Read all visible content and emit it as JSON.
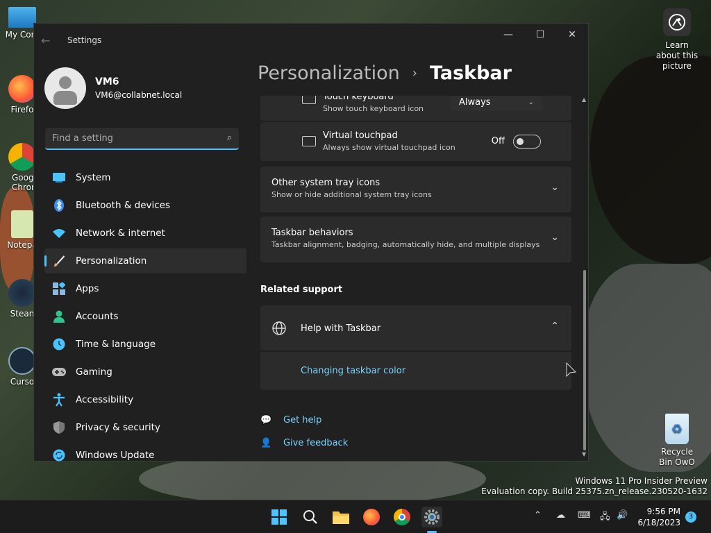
{
  "desktop": {
    "icons_left": [
      {
        "label": "My Com",
        "icon": "monitor-icon"
      },
      {
        "label": "Firefo",
        "icon": "firefox-icon"
      },
      {
        "label": "Goog Chron",
        "icon": "chrome-icon"
      },
      {
        "label": "Notepa",
        "icon": "notepad-icon"
      },
      {
        "label": "Stean",
        "icon": "steam-icon"
      },
      {
        "label": "Curso",
        "icon": "cursor-icon"
      }
    ],
    "learn_about": "Learn about this picture",
    "recycle_bin": "Recycle Bin OwO",
    "watermark_line1": "Windows 11 Pro Insider Preview",
    "watermark_line2": "Evaluation copy. Build 25375.zn_release.230520-1632"
  },
  "window": {
    "title": "Settings",
    "controls": [
      "—",
      "☐",
      "✕"
    ]
  },
  "profile": {
    "name": "VM6",
    "email": "VM6@collabnet.local"
  },
  "search": {
    "placeholder": "Find a setting"
  },
  "nav": [
    {
      "label": "System",
      "icon": "system-icon",
      "color": "#4cc2ff"
    },
    {
      "label": "Bluetooth & devices",
      "icon": "bluetooth-icon",
      "color": "#3b8eea"
    },
    {
      "label": "Network & internet",
      "icon": "wifi-icon",
      "color": "#4cc2ff"
    },
    {
      "label": "Personalization",
      "icon": "brush-icon",
      "color": "#e8a87c",
      "active": true
    },
    {
      "label": "Apps",
      "icon": "apps-icon",
      "color": "#8fb8de"
    },
    {
      "label": "Accounts",
      "icon": "accounts-icon",
      "color": "#2cc58b"
    },
    {
      "label": "Time & language",
      "icon": "time-language-icon",
      "color": "#4cc2ff"
    },
    {
      "label": "Gaming",
      "icon": "gaming-icon",
      "color": "#aaa"
    },
    {
      "label": "Accessibility",
      "icon": "accessibility-icon",
      "color": "#4cc2ff"
    },
    {
      "label": "Privacy & security",
      "icon": "shield-icon",
      "color": "#aaa"
    },
    {
      "label": "Windows Update",
      "icon": "update-icon",
      "color": "#4cc2ff"
    }
  ],
  "content": {
    "breadcrumb_parent": "Personalization",
    "breadcrumb_sep": "›",
    "breadcrumb_current": "Taskbar",
    "touch_keyboard": {
      "title": "Touch keyboard",
      "subtitle": "Show touch keyboard icon",
      "value": "Always"
    },
    "virtual_touchpad": {
      "title": "Virtual touchpad",
      "subtitle": "Always show virtual touchpad icon",
      "state": "Off"
    },
    "other_tray": {
      "title": "Other system tray icons",
      "subtitle": "Show or hide additional system tray icons"
    },
    "behaviors": {
      "title": "Taskbar behaviors",
      "subtitle": "Taskbar alignment, badging, automatically hide, and multiple displays"
    },
    "related_support": "Related support",
    "help_with": "Help with Taskbar",
    "help_link": "Changing taskbar color",
    "get_help": "Get help",
    "give_feedback": "Give feedback"
  },
  "taskbar": {
    "apps": [
      "start-icon",
      "search-icon",
      "file-explorer-icon",
      "firefox-icon",
      "chrome-icon",
      "settings-icon"
    ],
    "time": "9:56 PM",
    "date": "6/18/2023",
    "notifications": "3"
  },
  "colors": {
    "accent": "#4cc2ff",
    "link": "#7ad3ff"
  }
}
